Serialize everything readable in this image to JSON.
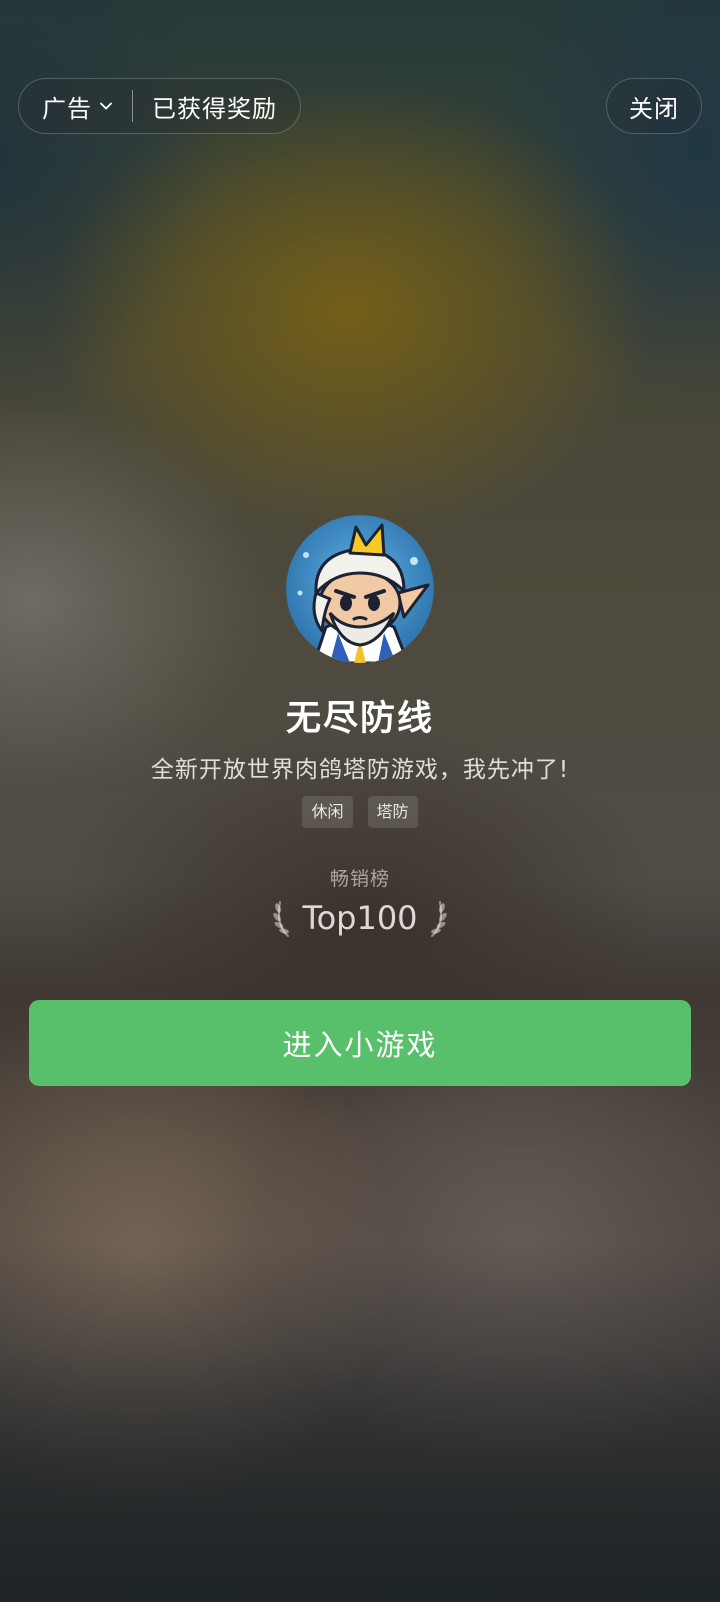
{
  "top_bar": {
    "ad_label": "广告",
    "reward_label": "已获得奖励",
    "close_label": "关闭"
  },
  "game": {
    "title": "无尽防线",
    "description": "全新开放世界肉鸽塔防游戏，我先冲了!",
    "tags": [
      "休闲",
      "塔防"
    ],
    "rank_label": "畅销榜",
    "rank_value": "Top100"
  },
  "cta": {
    "label": "进入小游戏",
    "color": "#58bf6b"
  },
  "icons": {
    "ad_menu": "chevron-down-icon",
    "rank": "laurel-icon",
    "avatar": "game-avatar"
  }
}
